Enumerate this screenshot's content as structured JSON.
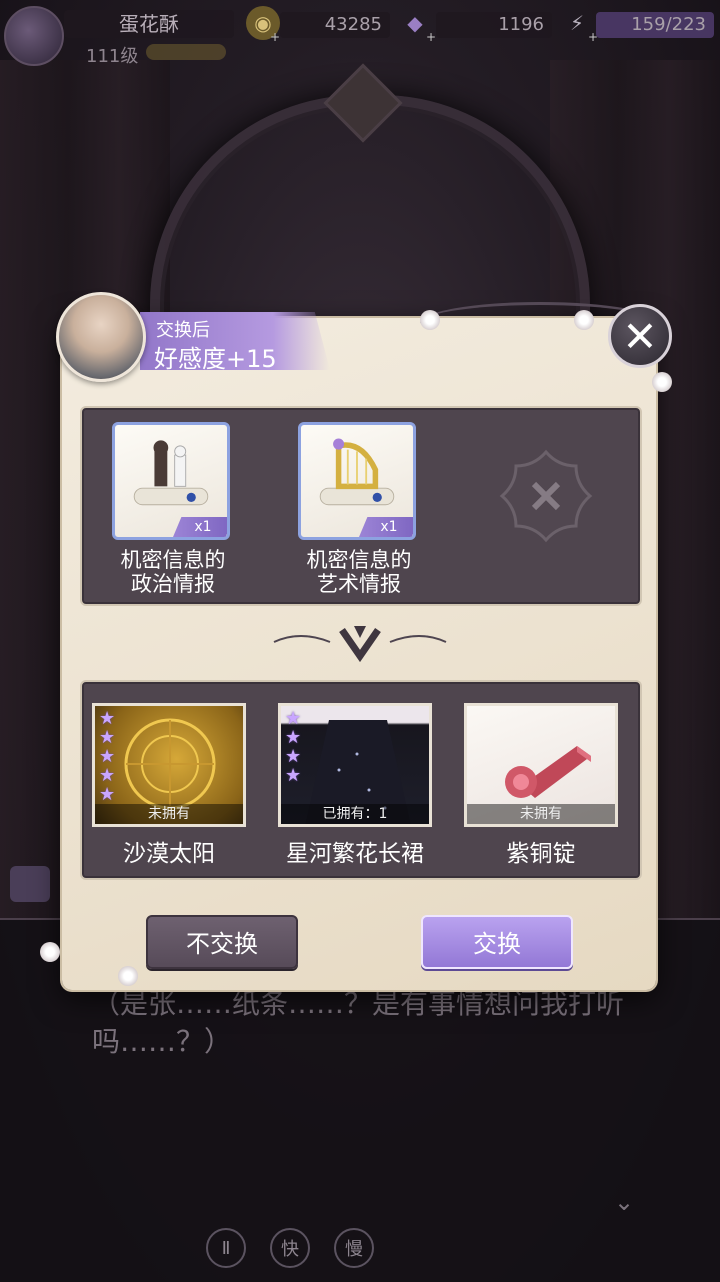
{
  "hud": {
    "player_name": "蛋花酥",
    "level": "111级",
    "gold": "43285",
    "diamonds": "1196",
    "stamina": "159/223",
    "plus": "+"
  },
  "dialogue": {
    "text": "（是张……纸条……？是有事情想问我打听吗……？）",
    "buttons": {
      "pause": "Ⅱ",
      "fast": "快",
      "slow": "慢"
    }
  },
  "popup": {
    "header": {
      "subtitle": "交换后",
      "bonus": "好感度+15"
    },
    "close_symbol": "✕",
    "cost_items": [
      {
        "name_line1": "机密信息的",
        "name_line2": "政治情报",
        "qty": "x1"
      },
      {
        "name_line1": "机密信息的",
        "name_line2": "艺术情报",
        "qty": "x1"
      }
    ],
    "rewards": [
      {
        "name": "沙漠太阳",
        "owned": "未拥有",
        "stars": 5
      },
      {
        "name": "星河繁花长裙",
        "owned": "已拥有：1",
        "stars": 4
      },
      {
        "name": "紫铜锭",
        "owned": "未拥有",
        "stars": 0
      }
    ],
    "cancel_label": "不交换",
    "confirm_label": "交换"
  },
  "colors": {
    "accent_purple": "#9b82dc",
    "parchment": "#ede4d2",
    "panel": "#4f454e",
    "star": "#c9a6ff"
  }
}
